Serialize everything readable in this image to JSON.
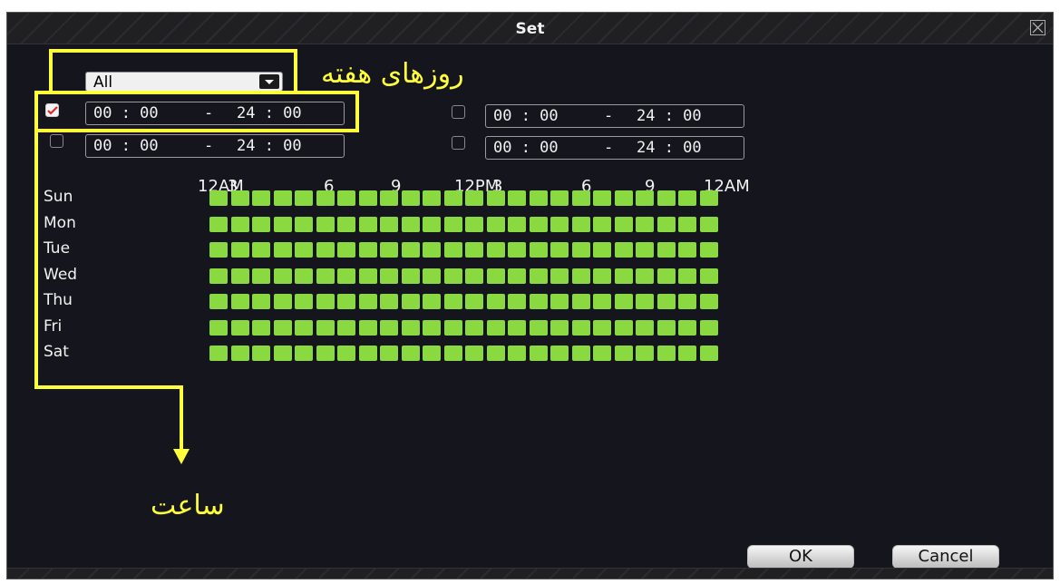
{
  "dialog": {
    "title": "Set",
    "day_select": {
      "value": "All"
    },
    "periods": [
      {
        "checked": true,
        "start": "00 : 00",
        "sep": "-",
        "end": "24 : 00"
      },
      {
        "checked": false,
        "start": "00 : 00",
        "sep": "-",
        "end": "24 : 00"
      },
      {
        "checked": false,
        "start": "00 : 00",
        "sep": "-",
        "end": "24 : 00"
      },
      {
        "checked": false,
        "start": "00 : 00",
        "sep": "-",
        "end": "24 : 00"
      }
    ],
    "hour_labels": [
      "12AM",
      "3",
      "6",
      "9",
      "12PM",
      "3",
      "6",
      "9",
      "12AM"
    ],
    "days": [
      "Sun",
      "Mon",
      "Tue",
      "Wed",
      "Thu",
      "Fri",
      "Sat"
    ],
    "hours_per_day": 24,
    "active_color": "#8ad941",
    "buttons": {
      "ok": "OK",
      "cancel": "Cancel"
    }
  },
  "annotations": {
    "days_of_week": "روزهای هفته",
    "hour": "ساعت",
    "color": "#ffff3b"
  }
}
